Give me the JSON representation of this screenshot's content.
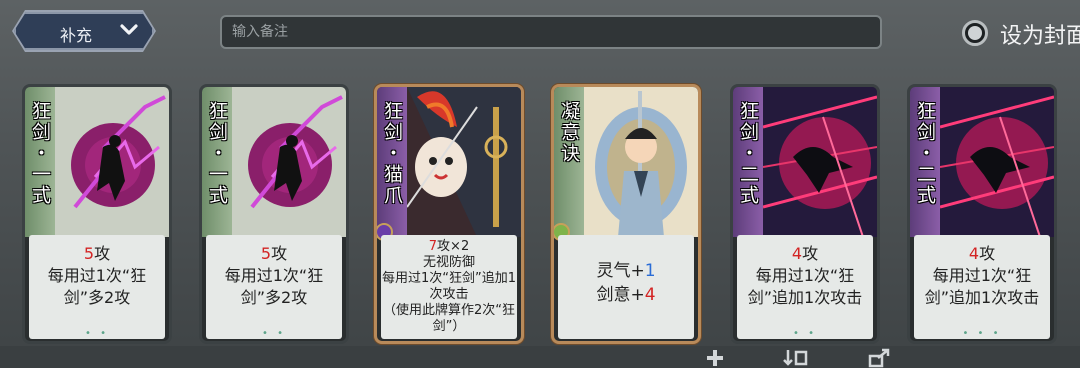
{
  "header": {
    "category_label": "补充",
    "note_placeholder": "输入备注",
    "cover_label": "设为封面"
  },
  "cards": [
    {
      "name": "狂剑・一式",
      "desc_parts": [
        {
          "t": "5",
          "c": "red"
        },
        {
          "t": "攻\n每用过1次“狂剑”多2攻",
          "c": ""
        }
      ],
      "theme": "green"
    },
    {
      "name": "狂剑・一式",
      "desc_parts": [
        {
          "t": "5",
          "c": "red"
        },
        {
          "t": "攻\n每用过1次“狂剑”多2攻",
          "c": ""
        }
      ],
      "theme": "green"
    },
    {
      "name": "狂剑・猫爪",
      "desc_parts": [
        {
          "t": "7",
          "c": "red"
        },
        {
          "t": "攻×2\n无视防御\n每用过1次“狂剑”追加1次攻击\n（使用此牌算作2次“狂剑”）",
          "c": ""
        }
      ],
      "theme": "purple-rare"
    },
    {
      "name": "凝意诀",
      "desc_parts": [
        {
          "t": "灵气+",
          "c": ""
        },
        {
          "t": "1",
          "c": "blue"
        },
        {
          "t": "\n剑意+",
          "c": ""
        },
        {
          "t": "4",
          "c": "red"
        }
      ],
      "theme": "green-rare"
    },
    {
      "name": "狂剑・二式",
      "desc_parts": [
        {
          "t": "4",
          "c": "red"
        },
        {
          "t": "攻\n每用过1次“狂剑”追加1次攻击",
          "c": ""
        }
      ],
      "theme": "purple"
    },
    {
      "name": "狂剑・二式",
      "desc_parts": [
        {
          "t": "4",
          "c": "red"
        },
        {
          "t": "攻\n每用过1次“狂剑”追加1次攻击",
          "c": ""
        }
      ],
      "theme": "purple"
    }
  ],
  "colors": {
    "accent_red": "#d32424",
    "accent_blue": "#2a6cd6",
    "strip_green": "#7fa07c",
    "strip_purple": "#7b4ea0"
  }
}
